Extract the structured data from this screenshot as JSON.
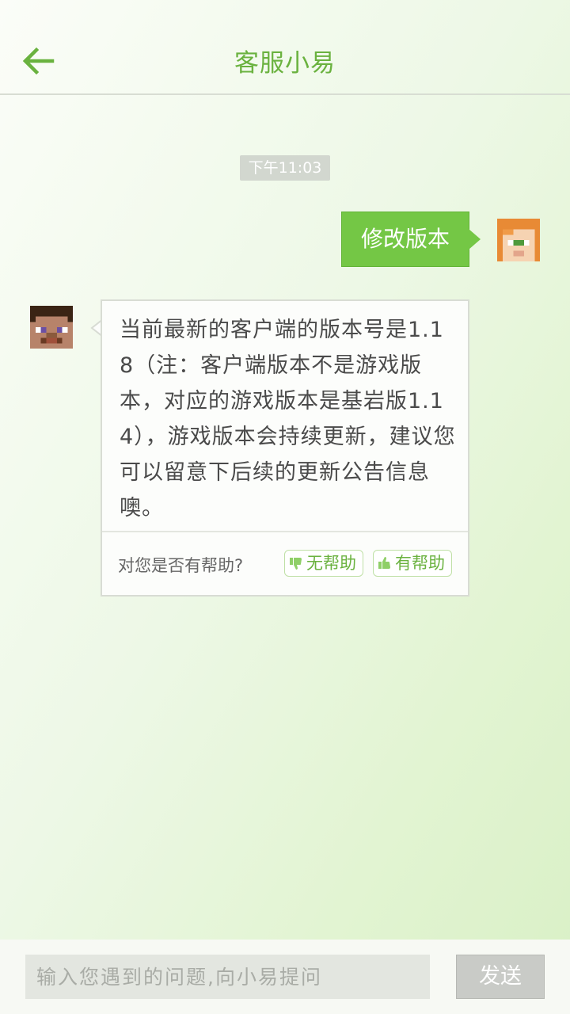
{
  "header": {
    "title": "客服小易"
  },
  "chat": {
    "timestamp": "下午11:03",
    "user_message": "修改版本",
    "bot_message": "当前最新的客户端的版本号是1.18（注：客户端版本不是游戏版本，对应的游戏版本是基岩版1.14），游戏版本会持续更新，建议您可以留意下后续的更新公告信息噢。",
    "feedback": {
      "question": "对您是否有帮助?",
      "not_helpful_label": "无帮助",
      "helpful_label": "有帮助"
    }
  },
  "input_bar": {
    "placeholder": "输入您遇到的问题,向小易提问",
    "send_label": "发送"
  },
  "icons": {
    "back": "arrow-left-icon",
    "thumbs_down": "thumbs-down-icon",
    "thumbs_up": "thumbs-up-icon"
  },
  "colors": {
    "accent": "#6ab23f",
    "user_bubble": "#74c745"
  }
}
